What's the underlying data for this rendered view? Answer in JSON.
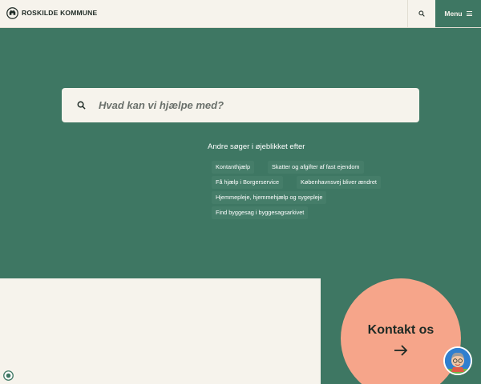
{
  "header": {
    "brand": "ROSKILDE KOMMUNE",
    "menu_label": "Menu",
    "search_icon": "search-icon",
    "menu_icon": "hamburger-icon"
  },
  "search": {
    "placeholder": "Hvad kan vi hjælpe med?",
    "icon": "search-icon"
  },
  "suggestions": {
    "title": "Andre søger i øjeblikket efter",
    "items": [
      "Kontanthjælp",
      "Skatter og afgifter af fast ejendom",
      "Få hjælp i Borgerservice",
      "Københavnsvej bliver ændret",
      "Hjemmepleje, hjemmehjælp og sygepleje",
      "Find byggesag i byggesagsarkivet"
    ]
  },
  "contact": {
    "label": "Kontakt os",
    "icon": "arrow-right-icon"
  },
  "colors": {
    "green": "#3e7763",
    "cream": "#f6f3ec",
    "salmon": "#f6a58a",
    "dark": "#1e2a25"
  }
}
